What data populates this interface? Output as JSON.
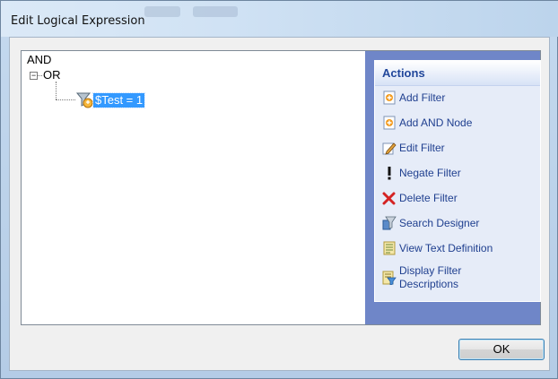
{
  "window": {
    "title": "Edit Logical Expression"
  },
  "tree": {
    "root": "AND",
    "child": "OR",
    "leaf": "$Test = 1"
  },
  "actions": {
    "header": "Actions",
    "items": [
      {
        "label": "Add Filter",
        "icon": "add-filter-icon"
      },
      {
        "label": "Add AND Node",
        "icon": "add-and-node-icon"
      },
      {
        "label": "Edit Filter",
        "icon": "edit-filter-icon"
      },
      {
        "label": "Negate Filter",
        "icon": "negate-filter-icon"
      },
      {
        "label": "Delete Filter",
        "icon": "delete-filter-icon"
      },
      {
        "label": "Search Designer",
        "icon": "search-designer-icon"
      },
      {
        "label": "View Text Definition",
        "icon": "view-text-definition-icon"
      },
      {
        "label": "Display Filter",
        "label2": "Descriptions",
        "icon": "display-filter-descriptions-icon"
      }
    ]
  },
  "buttons": {
    "ok": "OK"
  },
  "colors": {
    "selection": "#3399ff",
    "actions_pane": "#6f86c8",
    "actions_text": "#1f3f8f",
    "actions_header_text": "#21479b"
  }
}
